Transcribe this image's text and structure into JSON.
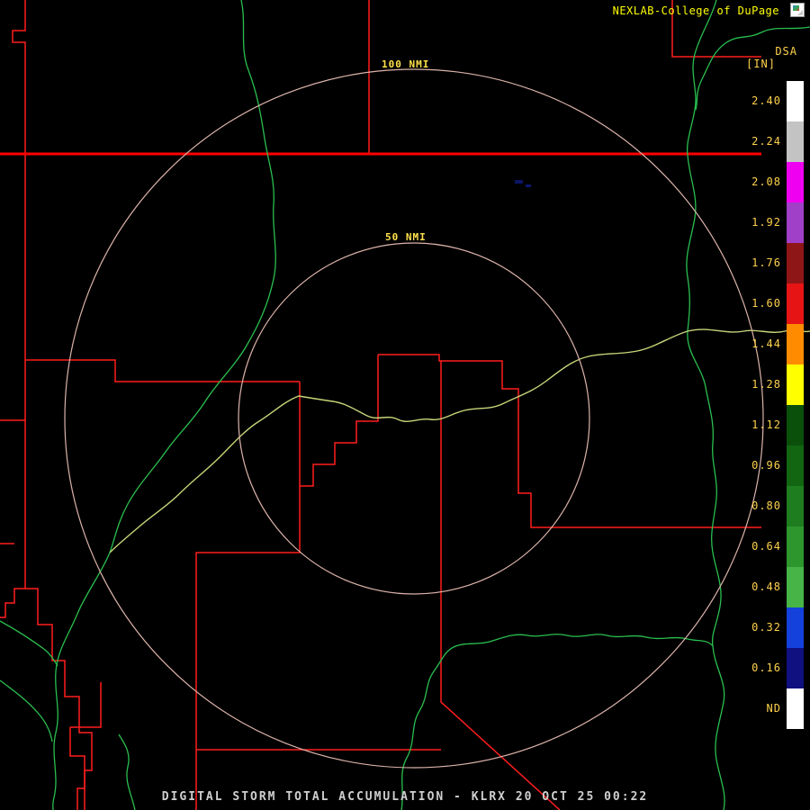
{
  "header": {
    "attribution": "NEXLAB-College of DuPage",
    "logo_icon": "broken-image-icon"
  },
  "map": {
    "range_rings": [
      {
        "label": "100 NMI"
      },
      {
        "label": "50 NMI"
      }
    ]
  },
  "legend": {
    "product_label": "DSA",
    "units_label": "[IN]",
    "entries": [
      {
        "label": "2.40",
        "color": "#ffffff"
      },
      {
        "label": "2.24",
        "color": "#c3c3c3"
      },
      {
        "label": "2.08",
        "color": "#f000f0"
      },
      {
        "label": "1.92",
        "color": "#a040c8"
      },
      {
        "label": "1.76",
        "color": "#8f1616"
      },
      {
        "label": "1.60",
        "color": "#e61414"
      },
      {
        "label": "1.44",
        "color": "#ff8c00"
      },
      {
        "label": "1.28",
        "color": "#ffff00"
      },
      {
        "label": "1.12",
        "color": "#0a500a"
      },
      {
        "label": "0.96",
        "color": "#126612"
      },
      {
        "label": "0.80",
        "color": "#1e7d1e"
      },
      {
        "label": "0.64",
        "color": "#2d962d"
      },
      {
        "label": "0.48",
        "color": "#46b446"
      },
      {
        "label": "0.32",
        "color": "#1440dc"
      },
      {
        "label": "0.16",
        "color": "#101080"
      },
      {
        "label": "ND",
        "color": "#ffffff"
      }
    ]
  },
  "footer": {
    "caption": "DIGITAL STORM TOTAL ACCUMULATION - KLRX 20 OCT 25 00:22"
  },
  "colors": {
    "background": "#000000",
    "state_boundary": "#ff0000",
    "county_boundary": "#ff1e1e",
    "river": "#2abf4f",
    "main_river": "#c9d479",
    "range_ring": "#dcb4aa",
    "attribution_text": "#ffff00",
    "scale_text": "#ffd24d",
    "caption_text": "#cfcfcf"
  }
}
